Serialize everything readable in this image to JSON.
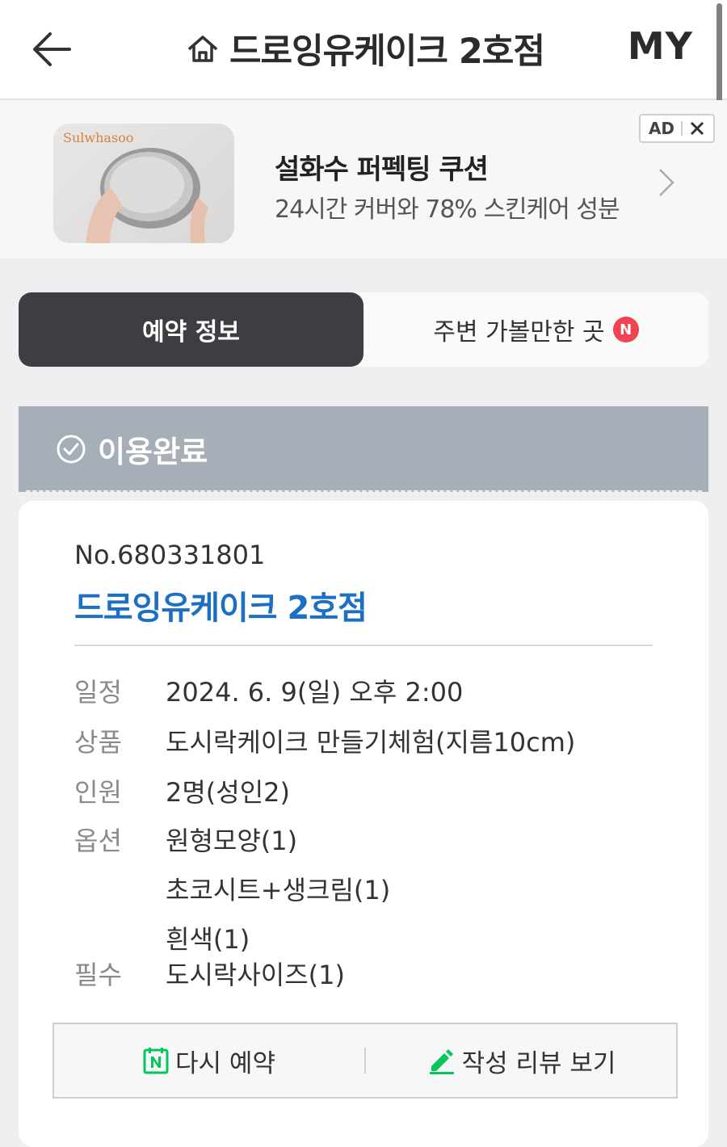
{
  "header": {
    "title": "드로잉유케이크 2호점",
    "my_label": "MY"
  },
  "ad": {
    "brand": "Sulwhasoo",
    "title": "설화수 퍼펙팅 쿠션",
    "subtitle": "24시간 커버와 78% 스킨케어 성분",
    "badge_label": "AD"
  },
  "tabs": [
    {
      "label": "예약 정보",
      "active": true
    },
    {
      "label": "주변 가볼만한 곳",
      "badge": "N",
      "active": false
    }
  ],
  "status": {
    "label": "이용완료"
  },
  "reservation": {
    "number": "No.680331801",
    "store": "드로잉유케이크 2호점",
    "rows": [
      {
        "label": "일정",
        "values": [
          "2024. 6. 9(일) 오후 2:00"
        ]
      },
      {
        "label": "상품",
        "values": [
          "도시락케이크 만들기체험(지름10cm)"
        ]
      },
      {
        "label": "인원",
        "values": [
          "2명(성인2)"
        ]
      },
      {
        "label": "옵션",
        "values": [
          "원형모양(1)",
          "초코시트+생크림(1)",
          "흰색(1)"
        ]
      },
      {
        "label": "필수",
        "values": [
          "도시락사이즈(1)"
        ]
      }
    ]
  },
  "actions": {
    "rebook_label": "다시 예약",
    "review_label": "작성 리뷰 보기"
  },
  "colors": {
    "accent_blue": "#1d6fc4",
    "tab_active_bg": "#3e3d42",
    "status_bg": "#a6afb8",
    "naver_green": "#03c75a",
    "badge_red": "#f04452"
  }
}
